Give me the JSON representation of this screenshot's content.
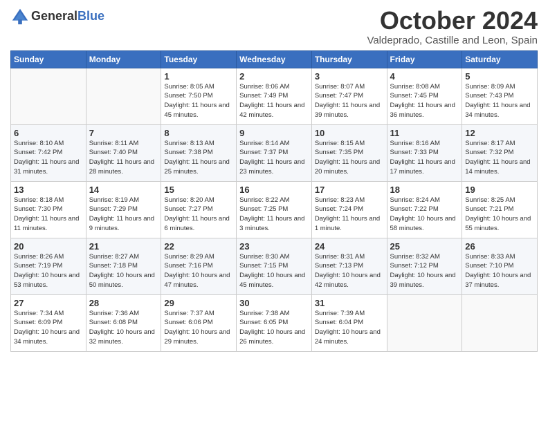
{
  "logo": {
    "general": "General",
    "blue": "Blue"
  },
  "header": {
    "month": "October 2024",
    "location": "Valdeprado, Castille and Leon, Spain"
  },
  "weekdays": [
    "Sunday",
    "Monday",
    "Tuesday",
    "Wednesday",
    "Thursday",
    "Friday",
    "Saturday"
  ],
  "weeks": [
    [
      {
        "day": "",
        "info": ""
      },
      {
        "day": "",
        "info": ""
      },
      {
        "day": "1",
        "info": "Sunrise: 8:05 AM\nSunset: 7:50 PM\nDaylight: 11 hours and 45 minutes."
      },
      {
        "day": "2",
        "info": "Sunrise: 8:06 AM\nSunset: 7:49 PM\nDaylight: 11 hours and 42 minutes."
      },
      {
        "day": "3",
        "info": "Sunrise: 8:07 AM\nSunset: 7:47 PM\nDaylight: 11 hours and 39 minutes."
      },
      {
        "day": "4",
        "info": "Sunrise: 8:08 AM\nSunset: 7:45 PM\nDaylight: 11 hours and 36 minutes."
      },
      {
        "day": "5",
        "info": "Sunrise: 8:09 AM\nSunset: 7:43 PM\nDaylight: 11 hours and 34 minutes."
      }
    ],
    [
      {
        "day": "6",
        "info": "Sunrise: 8:10 AM\nSunset: 7:42 PM\nDaylight: 11 hours and 31 minutes."
      },
      {
        "day": "7",
        "info": "Sunrise: 8:11 AM\nSunset: 7:40 PM\nDaylight: 11 hours and 28 minutes."
      },
      {
        "day": "8",
        "info": "Sunrise: 8:13 AM\nSunset: 7:38 PM\nDaylight: 11 hours and 25 minutes."
      },
      {
        "day": "9",
        "info": "Sunrise: 8:14 AM\nSunset: 7:37 PM\nDaylight: 11 hours and 23 minutes."
      },
      {
        "day": "10",
        "info": "Sunrise: 8:15 AM\nSunset: 7:35 PM\nDaylight: 11 hours and 20 minutes."
      },
      {
        "day": "11",
        "info": "Sunrise: 8:16 AM\nSunset: 7:33 PM\nDaylight: 11 hours and 17 minutes."
      },
      {
        "day": "12",
        "info": "Sunrise: 8:17 AM\nSunset: 7:32 PM\nDaylight: 11 hours and 14 minutes."
      }
    ],
    [
      {
        "day": "13",
        "info": "Sunrise: 8:18 AM\nSunset: 7:30 PM\nDaylight: 11 hours and 11 minutes."
      },
      {
        "day": "14",
        "info": "Sunrise: 8:19 AM\nSunset: 7:29 PM\nDaylight: 11 hours and 9 minutes."
      },
      {
        "day": "15",
        "info": "Sunrise: 8:20 AM\nSunset: 7:27 PM\nDaylight: 11 hours and 6 minutes."
      },
      {
        "day": "16",
        "info": "Sunrise: 8:22 AM\nSunset: 7:25 PM\nDaylight: 11 hours and 3 minutes."
      },
      {
        "day": "17",
        "info": "Sunrise: 8:23 AM\nSunset: 7:24 PM\nDaylight: 11 hours and 1 minute."
      },
      {
        "day": "18",
        "info": "Sunrise: 8:24 AM\nSunset: 7:22 PM\nDaylight: 10 hours and 58 minutes."
      },
      {
        "day": "19",
        "info": "Sunrise: 8:25 AM\nSunset: 7:21 PM\nDaylight: 10 hours and 55 minutes."
      }
    ],
    [
      {
        "day": "20",
        "info": "Sunrise: 8:26 AM\nSunset: 7:19 PM\nDaylight: 10 hours and 53 minutes."
      },
      {
        "day": "21",
        "info": "Sunrise: 8:27 AM\nSunset: 7:18 PM\nDaylight: 10 hours and 50 minutes."
      },
      {
        "day": "22",
        "info": "Sunrise: 8:29 AM\nSunset: 7:16 PM\nDaylight: 10 hours and 47 minutes."
      },
      {
        "day": "23",
        "info": "Sunrise: 8:30 AM\nSunset: 7:15 PM\nDaylight: 10 hours and 45 minutes."
      },
      {
        "day": "24",
        "info": "Sunrise: 8:31 AM\nSunset: 7:13 PM\nDaylight: 10 hours and 42 minutes."
      },
      {
        "day": "25",
        "info": "Sunrise: 8:32 AM\nSunset: 7:12 PM\nDaylight: 10 hours and 39 minutes."
      },
      {
        "day": "26",
        "info": "Sunrise: 8:33 AM\nSunset: 7:10 PM\nDaylight: 10 hours and 37 minutes."
      }
    ],
    [
      {
        "day": "27",
        "info": "Sunrise: 7:34 AM\nSunset: 6:09 PM\nDaylight: 10 hours and 34 minutes."
      },
      {
        "day": "28",
        "info": "Sunrise: 7:36 AM\nSunset: 6:08 PM\nDaylight: 10 hours and 32 minutes."
      },
      {
        "day": "29",
        "info": "Sunrise: 7:37 AM\nSunset: 6:06 PM\nDaylight: 10 hours and 29 minutes."
      },
      {
        "day": "30",
        "info": "Sunrise: 7:38 AM\nSunset: 6:05 PM\nDaylight: 10 hours and 26 minutes."
      },
      {
        "day": "31",
        "info": "Sunrise: 7:39 AM\nSunset: 6:04 PM\nDaylight: 10 hours and 24 minutes."
      },
      {
        "day": "",
        "info": ""
      },
      {
        "day": "",
        "info": ""
      }
    ]
  ]
}
